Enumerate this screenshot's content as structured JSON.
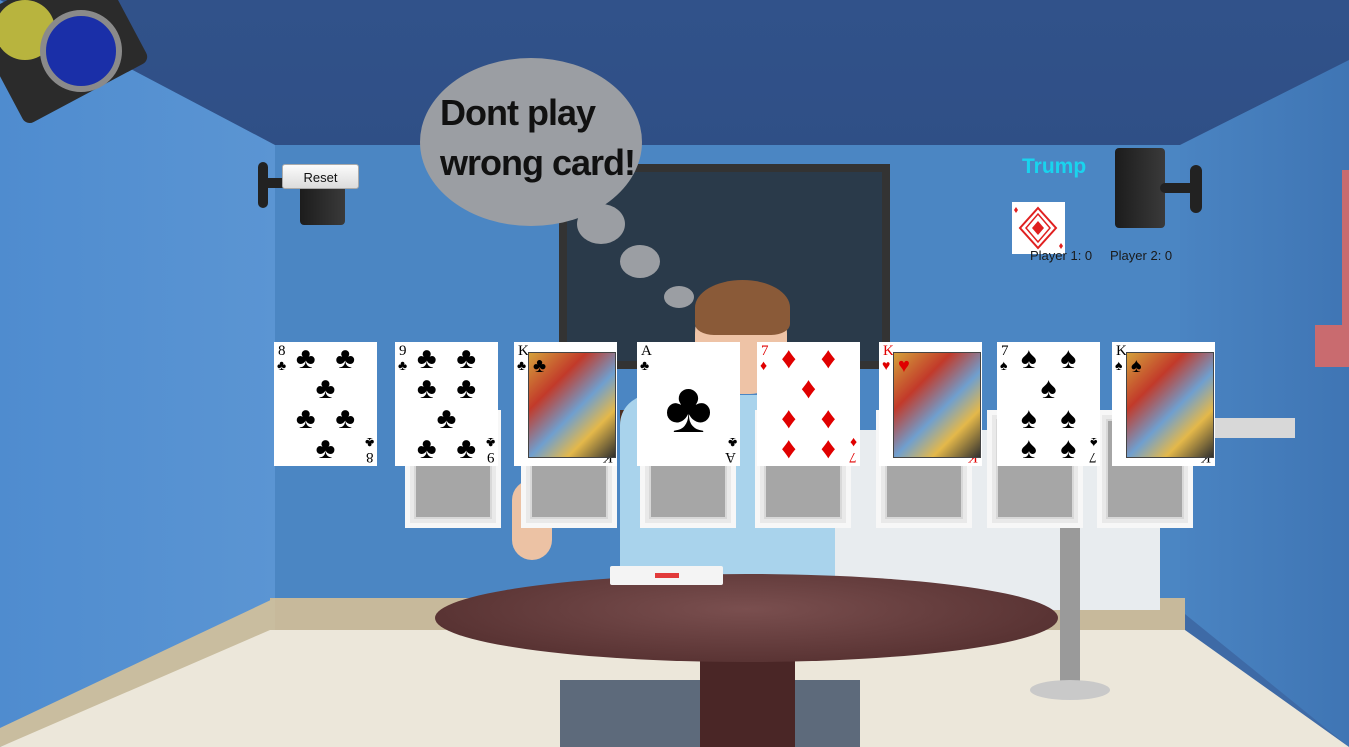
{
  "bubble": {
    "line1": "Dont play",
    "line2": "wrong card!"
  },
  "controls": {
    "reset_label": "Reset"
  },
  "trump": {
    "label": "Trump",
    "card_suit": "♦",
    "color": "#19d4ee"
  },
  "scores": {
    "player1": "Player 1: 0",
    "player2": "Player 2: 0"
  },
  "hand": [
    {
      "rank": "8",
      "suit": "♣",
      "color": "black",
      "kind": "pips"
    },
    {
      "rank": "9",
      "suit": "♣",
      "color": "black",
      "kind": "pips"
    },
    {
      "rank": "K",
      "suit": "♣",
      "color": "black",
      "kind": "face"
    },
    {
      "rank": "A",
      "suit": "♣",
      "color": "black",
      "kind": "ace"
    },
    {
      "rank": "7",
      "suit": "♦",
      "color": "red",
      "kind": "pips"
    },
    {
      "rank": "K",
      "suit": "♥",
      "color": "red",
      "kind": "face"
    },
    {
      "rank": "7",
      "suit": "♠",
      "color": "black",
      "kind": "pips"
    },
    {
      "rank": "K",
      "suit": "♠",
      "color": "black",
      "kind": "face"
    }
  ],
  "opponent_hand_count": 7,
  "played_card": {
    "suit": "♦"
  }
}
